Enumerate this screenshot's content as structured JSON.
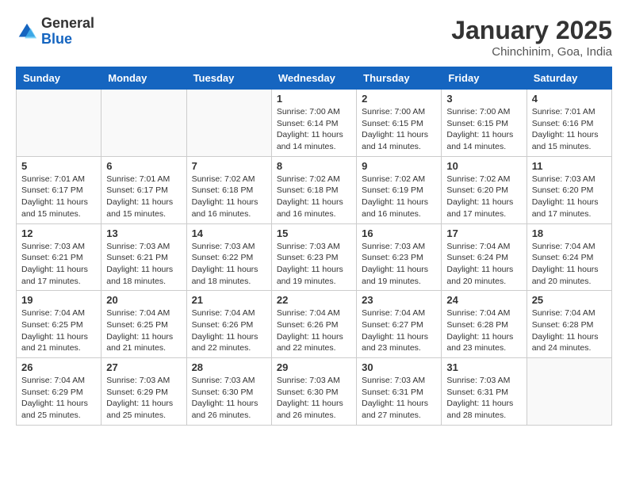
{
  "header": {
    "logo_general": "General",
    "logo_blue": "Blue",
    "month": "January 2025",
    "location": "Chinchinim, Goa, India"
  },
  "weekdays": [
    "Sunday",
    "Monday",
    "Tuesday",
    "Wednesday",
    "Thursday",
    "Friday",
    "Saturday"
  ],
  "weeks": [
    [
      {
        "day": "",
        "info": ""
      },
      {
        "day": "",
        "info": ""
      },
      {
        "day": "",
        "info": ""
      },
      {
        "day": "1",
        "info": "Sunrise: 7:00 AM\nSunset: 6:14 PM\nDaylight: 11 hours\nand 14 minutes."
      },
      {
        "day": "2",
        "info": "Sunrise: 7:00 AM\nSunset: 6:15 PM\nDaylight: 11 hours\nand 14 minutes."
      },
      {
        "day": "3",
        "info": "Sunrise: 7:00 AM\nSunset: 6:15 PM\nDaylight: 11 hours\nand 14 minutes."
      },
      {
        "day": "4",
        "info": "Sunrise: 7:01 AM\nSunset: 6:16 PM\nDaylight: 11 hours\nand 15 minutes."
      }
    ],
    [
      {
        "day": "5",
        "info": "Sunrise: 7:01 AM\nSunset: 6:17 PM\nDaylight: 11 hours\nand 15 minutes."
      },
      {
        "day": "6",
        "info": "Sunrise: 7:01 AM\nSunset: 6:17 PM\nDaylight: 11 hours\nand 15 minutes."
      },
      {
        "day": "7",
        "info": "Sunrise: 7:02 AM\nSunset: 6:18 PM\nDaylight: 11 hours\nand 16 minutes."
      },
      {
        "day": "8",
        "info": "Sunrise: 7:02 AM\nSunset: 6:18 PM\nDaylight: 11 hours\nand 16 minutes."
      },
      {
        "day": "9",
        "info": "Sunrise: 7:02 AM\nSunset: 6:19 PM\nDaylight: 11 hours\nand 16 minutes."
      },
      {
        "day": "10",
        "info": "Sunrise: 7:02 AM\nSunset: 6:20 PM\nDaylight: 11 hours\nand 17 minutes."
      },
      {
        "day": "11",
        "info": "Sunrise: 7:03 AM\nSunset: 6:20 PM\nDaylight: 11 hours\nand 17 minutes."
      }
    ],
    [
      {
        "day": "12",
        "info": "Sunrise: 7:03 AM\nSunset: 6:21 PM\nDaylight: 11 hours\nand 17 minutes."
      },
      {
        "day": "13",
        "info": "Sunrise: 7:03 AM\nSunset: 6:21 PM\nDaylight: 11 hours\nand 18 minutes."
      },
      {
        "day": "14",
        "info": "Sunrise: 7:03 AM\nSunset: 6:22 PM\nDaylight: 11 hours\nand 18 minutes."
      },
      {
        "day": "15",
        "info": "Sunrise: 7:03 AM\nSunset: 6:23 PM\nDaylight: 11 hours\nand 19 minutes."
      },
      {
        "day": "16",
        "info": "Sunrise: 7:03 AM\nSunset: 6:23 PM\nDaylight: 11 hours\nand 19 minutes."
      },
      {
        "day": "17",
        "info": "Sunrise: 7:04 AM\nSunset: 6:24 PM\nDaylight: 11 hours\nand 20 minutes."
      },
      {
        "day": "18",
        "info": "Sunrise: 7:04 AM\nSunset: 6:24 PM\nDaylight: 11 hours\nand 20 minutes."
      }
    ],
    [
      {
        "day": "19",
        "info": "Sunrise: 7:04 AM\nSunset: 6:25 PM\nDaylight: 11 hours\nand 21 minutes."
      },
      {
        "day": "20",
        "info": "Sunrise: 7:04 AM\nSunset: 6:25 PM\nDaylight: 11 hours\nand 21 minutes."
      },
      {
        "day": "21",
        "info": "Sunrise: 7:04 AM\nSunset: 6:26 PM\nDaylight: 11 hours\nand 22 minutes."
      },
      {
        "day": "22",
        "info": "Sunrise: 7:04 AM\nSunset: 6:26 PM\nDaylight: 11 hours\nand 22 minutes."
      },
      {
        "day": "23",
        "info": "Sunrise: 7:04 AM\nSunset: 6:27 PM\nDaylight: 11 hours\nand 23 minutes."
      },
      {
        "day": "24",
        "info": "Sunrise: 7:04 AM\nSunset: 6:28 PM\nDaylight: 11 hours\nand 23 minutes."
      },
      {
        "day": "25",
        "info": "Sunrise: 7:04 AM\nSunset: 6:28 PM\nDaylight: 11 hours\nand 24 minutes."
      }
    ],
    [
      {
        "day": "26",
        "info": "Sunrise: 7:04 AM\nSunset: 6:29 PM\nDaylight: 11 hours\nand 25 minutes."
      },
      {
        "day": "27",
        "info": "Sunrise: 7:03 AM\nSunset: 6:29 PM\nDaylight: 11 hours\nand 25 minutes."
      },
      {
        "day": "28",
        "info": "Sunrise: 7:03 AM\nSunset: 6:30 PM\nDaylight: 11 hours\nand 26 minutes."
      },
      {
        "day": "29",
        "info": "Sunrise: 7:03 AM\nSunset: 6:30 PM\nDaylight: 11 hours\nand 26 minutes."
      },
      {
        "day": "30",
        "info": "Sunrise: 7:03 AM\nSunset: 6:31 PM\nDaylight: 11 hours\nand 27 minutes."
      },
      {
        "day": "31",
        "info": "Sunrise: 7:03 AM\nSunset: 6:31 PM\nDaylight: 11 hours\nand 28 minutes."
      },
      {
        "day": "",
        "info": ""
      }
    ]
  ]
}
